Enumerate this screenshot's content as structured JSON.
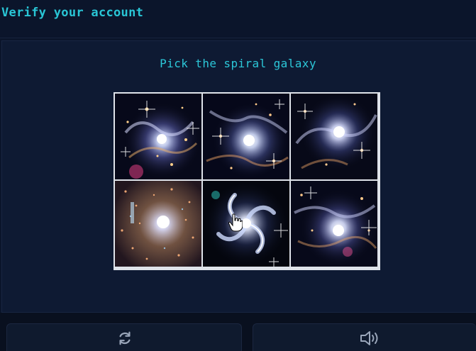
{
  "header": {
    "title": "Verify your account"
  },
  "challenge": {
    "prompt": "Pick the spiral galaxy",
    "tiles": [
      {
        "name": "galaxy-tile-1",
        "depicts": "irregular-galaxy"
      },
      {
        "name": "galaxy-tile-2",
        "depicts": "irregular-galaxy"
      },
      {
        "name": "galaxy-tile-3",
        "depicts": "irregular-galaxy"
      },
      {
        "name": "galaxy-tile-4",
        "depicts": "elliptical-galaxy"
      },
      {
        "name": "galaxy-tile-5",
        "depicts": "spiral-galaxy"
      },
      {
        "name": "galaxy-tile-6",
        "depicts": "irregular-galaxy"
      }
    ]
  },
  "footer": {
    "refresh_icon": "refresh-icon",
    "audio_icon": "speaker-icon"
  },
  "colors": {
    "background": "#0b152b",
    "panel": "#0e1a33",
    "accent": "#29c6d6",
    "grid_border": "#dfe3ea"
  }
}
